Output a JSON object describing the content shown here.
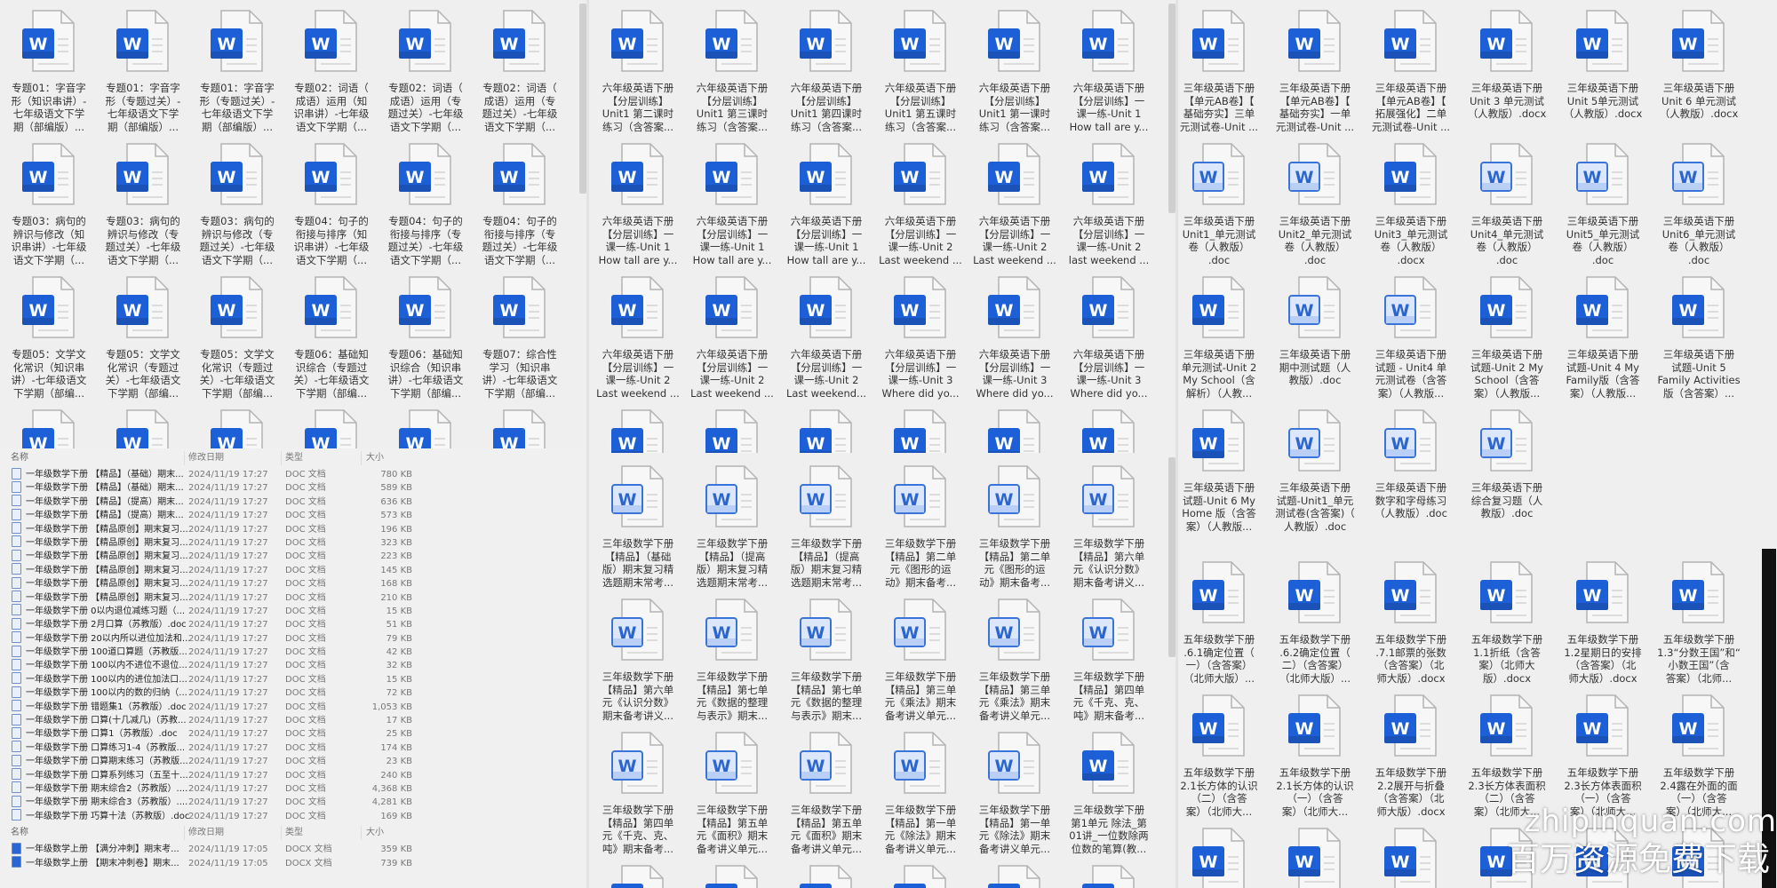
{
  "icons": {
    "solid": "word-solid",
    "light": "word-light",
    "accent": "#1d5fd6",
    "light_fill": "#dce7fb"
  },
  "left_grid": [
    {
      "label": "专题01：字音字\n形（知识串讲）-\n七年级语文下学\n期（部编版）...",
      "icon": "solid"
    },
    {
      "label": "专题01：字音字\n形（专题过关）-\n七年级语文下学\n期（部编版）...",
      "icon": "solid"
    },
    {
      "label": "专题01：字音字\n形（专题过关）-\n七年级语文下学\n期（部编版）...",
      "icon": "solid"
    },
    {
      "label": "专题02：词语（\n成语）运用（知\n识串讲）-七年级\n语文下学期（...",
      "icon": "solid"
    },
    {
      "label": "专题02：词语（\n成语）运用（专\n题过关）-七年级\n语文下学期（...",
      "icon": "solid"
    },
    {
      "label": "专题02：词语（\n成语）运用（专\n题过关）-七年级\n语文下学期（...",
      "icon": "solid"
    },
    {
      "label": "专题03：病句的\n辨识与修改（知\n识串讲）-七年级\n语文下学期（...",
      "icon": "solid"
    },
    {
      "label": "专题03：病句的\n辨识与修改（专\n题过关）-七年级\n语文下学期（...",
      "icon": "solid"
    },
    {
      "label": "专题03：病句的\n辨识与修改（专\n题过关）-七年级\n语文下学期（...",
      "icon": "solid"
    },
    {
      "label": "专题04：句子的\n衔接与排序（知\n识串讲）-七年级\n语文下学期（...",
      "icon": "solid"
    },
    {
      "label": "专题04：句子的\n衔接与排序（专\n题过关）-七年级\n语文下学期（...",
      "icon": "solid"
    },
    {
      "label": "专题04：句子的\n衔接与排序（专\n题过关）-七年级\n语文下学期（...",
      "icon": "solid"
    },
    {
      "label": "专题05：文学文\n化常识（知识串\n讲）-七年级语文\n下学期（部编...",
      "icon": "solid"
    },
    {
      "label": "专题05：文学文\n化常识（专题过\n关）-七年级语文\n下学期（部编...",
      "icon": "solid"
    },
    {
      "label": "专题05：文学文\n化常识（专题过\n关）-七年级语文\n下学期（部编...",
      "icon": "solid"
    },
    {
      "label": "专题06：基础知\n识综合（专题过\n关）-七年级语文\n下学期（部编...",
      "icon": "solid"
    },
    {
      "label": "专题06：基础知\n识综合（知识串\n讲）-七年级语文\n下学期（部编...",
      "icon": "solid"
    },
    {
      "label": "专题07：综合性\n学习（知识串\n讲）-七年级语文\n下学期（部编...",
      "icon": "solid"
    },
    {
      "label": "",
      "icon": "solid"
    },
    {
      "label": "",
      "icon": "solid"
    },
    {
      "label": "",
      "icon": "solid"
    },
    {
      "label": "",
      "icon": "solid"
    },
    {
      "label": "",
      "icon": "solid"
    },
    {
      "label": "",
      "icon": "solid"
    }
  ],
  "file_list": {
    "headers": {
      "name": "名称",
      "date": "修改日期",
      "type": "类型",
      "size": "大小"
    },
    "rows": [
      {
        "name": "一年级数学下册 【精品】（基础）期末...",
        "date": "2024/11/19 17:27",
        "type": "DOC 文档",
        "size": "780 KB"
      },
      {
        "name": "一年级数学下册 【精品】（基础）期末...",
        "date": "2024/11/19 17:27",
        "type": "DOC 文档",
        "size": "589 KB"
      },
      {
        "name": "一年级数学下册 【精品】（提高）期末...",
        "date": "2024/11/19 17:27",
        "type": "DOC 文档",
        "size": "636 KB"
      },
      {
        "name": "一年级数学下册 【精品】（提高）期末...",
        "date": "2024/11/19 17:27",
        "type": "DOC 文档",
        "size": "573 KB"
      },
      {
        "name": "一年级数学下册 【精品原创】期末复习...",
        "date": "2024/11/19 17:27",
        "type": "DOC 文档",
        "size": "196 KB"
      },
      {
        "name": "一年级数学下册 【精品原创】期末复习...",
        "date": "2024/11/19 17:27",
        "type": "DOC 文档",
        "size": "323 KB"
      },
      {
        "name": "一年级数学下册 【精品原创】期末复习...",
        "date": "2024/11/19 17:27",
        "type": "DOC 文档",
        "size": "223 KB"
      },
      {
        "name": "一年级数学下册 【精品原创】期末复习...",
        "date": "2024/11/19 17:27",
        "type": "DOC 文档",
        "size": "145 KB"
      },
      {
        "name": "一年级数学下册 【精品原创】期末复习...",
        "date": "2024/11/19 17:27",
        "type": "DOC 文档",
        "size": "168 KB"
      },
      {
        "name": "一年级数学下册 【精品原创】期末复习...",
        "date": "2024/11/19 17:27",
        "type": "DOC 文档",
        "size": "210 KB"
      },
      {
        "name": "一年级数学下册 0以内退位减练习题（...",
        "date": "2024/11/19 17:27",
        "type": "DOC 文档",
        "size": "15 KB"
      },
      {
        "name": "一年级数学下册 2月口算（苏教版）.doc",
        "date": "2024/11/19 17:27",
        "type": "DOC 文档",
        "size": "51 KB"
      },
      {
        "name": "一年级数学下册 20以内所以进位加法和...",
        "date": "2024/11/19 17:27",
        "type": "DOC 文档",
        "size": "79 KB"
      },
      {
        "name": "一年级数学下册 100道口算题（苏教版...",
        "date": "2024/11/19 17:27",
        "type": "DOC 文档",
        "size": "42 KB"
      },
      {
        "name": "一年级数学下册 100以内不进位不退位...",
        "date": "2024/11/19 17:27",
        "type": "DOC 文档",
        "size": "32 KB"
      },
      {
        "name": "一年级数学下册 100以内的进位加法口...",
        "date": "2024/11/19 17:27",
        "type": "DOC 文档",
        "size": "15 KB"
      },
      {
        "name": "一年级数学下册 100以内的数的归纳（...",
        "date": "2024/11/19 17:27",
        "type": "DOC 文档",
        "size": "72 KB"
      },
      {
        "name": "一年级数学下册 错题集1（苏教版）.doc",
        "date": "2024/11/19 17:27",
        "type": "DOC 文档",
        "size": "1,053 KB"
      },
      {
        "name": "一年级数学下册 口算(十几减几)（苏教...",
        "date": "2024/11/19 17:27",
        "type": "DOC 文档",
        "size": "17 KB"
      },
      {
        "name": "一年级数学下册 口算1（苏教版）.doc",
        "date": "2024/11/19 17:27",
        "type": "DOC 文档",
        "size": "25 KB"
      },
      {
        "name": "一年级数学下册 口算练习1-4（苏教版...",
        "date": "2024/11/19 17:27",
        "type": "DOC 文档",
        "size": "174 KB"
      },
      {
        "name": "一年级数学下册 口算期末练习（苏教版...",
        "date": "2024/11/19 17:27",
        "type": "DOC 文档",
        "size": "23 KB"
      },
      {
        "name": "一年级数学下册 口算系列练习（五至十...",
        "date": "2024/11/19 17:27",
        "type": "DOC 文档",
        "size": "240 KB"
      },
      {
        "name": "一年级数学下册 期末综合2（苏教版）....",
        "date": "2024/11/19 17:27",
        "type": "DOC 文档",
        "size": "4,368 KB"
      },
      {
        "name": "一年级数学下册 期末综合3（苏教版）....",
        "date": "2024/11/19 17:27",
        "type": "DOC 文档",
        "size": "4,281 KB"
      },
      {
        "name": "一年级数学下册 巧算十法（苏教版）.doc",
        "date": "2024/11/19 17:27",
        "type": "DOC 文档",
        "size": "169 KB"
      }
    ],
    "rows2": [
      {
        "name": "一年级数学上册 【满分冲刺】期末考...",
        "date": "2024/11/19 17:05",
        "type": "DOCX 文档",
        "size": "359 KB"
      },
      {
        "name": "一年级数学上册 【期末冲刺卷】期末...",
        "date": "2024/11/19 17:05",
        "type": "DOCX 文档",
        "size": "739 KB"
      }
    ]
  },
  "mid_grid": [
    {
      "label": "六年级英语下册\n【分层训练】\nUnit1 第二课时\n练习（含答案...",
      "icon": "solid"
    },
    {
      "label": "六年级英语下册\n【分层训练】\nUnit1 第三课时\n练习（含答案...",
      "icon": "solid"
    },
    {
      "label": "六年级英语下册\n【分层训练】\nUnit1 第四课时\n练习（含答案...",
      "icon": "solid"
    },
    {
      "label": "六年级英语下册\n【分层训练】\nUnit1 第五课时\n练习（含答案...",
      "icon": "solid"
    },
    {
      "label": "六年级英语下册\n【分层训练】\nUnit1 第一课时\n练习（含答案...",
      "icon": "solid"
    },
    {
      "label": "六年级英语下册\n【分层训练】一\n课一练-Unit 1\nHow tall are y...",
      "icon": "solid"
    },
    {
      "label": "六年级英语下册\n【分层训练】一\n课一练-Unit 1\nHow tall are y...",
      "icon": "solid"
    },
    {
      "label": "六年级英语下册\n【分层训练】一\n课一练-Unit 1\nHow tall are y...",
      "icon": "solid"
    },
    {
      "label": "六年级英语下册\n【分层训练】一\n课一练-Unit 1\nHow tall are y...",
      "icon": "solid"
    },
    {
      "label": "六年级英语下册\n【分层训练】一\n课一练-Unit 2\nLast weekend ...",
      "icon": "solid"
    },
    {
      "label": "六年级英语下册\n【分层训练】一\n课一练-Unit 2\nLast weekend ...",
      "icon": "solid"
    },
    {
      "label": "六年级英语下册\n【分层训练】一\n课一练-Unit 2\nlast weekend ...",
      "icon": "solid"
    },
    {
      "label": "六年级英语下册\n【分层训练】一\n课一练-Unit 2\nLast weekend ...",
      "icon": "solid"
    },
    {
      "label": "六年级英语下册\n【分层训练】一\n课一练-Unit 2\nLast weekend ...",
      "icon": "solid"
    },
    {
      "label": "六年级英语下册\n【分层训练】一\n课一练-Unit 2\nLast weekend...",
      "icon": "solid"
    },
    {
      "label": "六年级英语下册\n【分层训练】一\n课一练-Unit 3\nWhere did yo...",
      "icon": "solid"
    },
    {
      "label": "六年级英语下册\n【分层训练】一\n课一练-Unit 3\nWhere did yo...",
      "icon": "solid"
    },
    {
      "label": "六年级英语下册\n【分层训练】一\n课一练-Unit 3\nWhere did yo...",
      "icon": "solid"
    },
    {
      "label": "",
      "icon": "solid"
    },
    {
      "label": "",
      "icon": "solid"
    },
    {
      "label": "",
      "icon": "solid"
    },
    {
      "label": "",
      "icon": "solid"
    },
    {
      "label": "",
      "icon": "solid"
    },
    {
      "label": "",
      "icon": "solid"
    }
  ],
  "mid_math_grid": [
    {
      "label": "三年级数学下册\n【精品】（基础\n版）期末复习精\n选题期末常考...",
      "icon": "light"
    },
    {
      "label": "三年级数学下册\n【精品】（提高\n版）期末复习精\n选题期末常考...",
      "icon": "light"
    },
    {
      "label": "三年级数学下册\n【精品】（提高\n版）期末复习精\n选题期末常考...",
      "icon": "light"
    },
    {
      "label": "三年级数学下册\n【精品】第二单\n元《图形的运\n动》期末备考...",
      "icon": "light"
    },
    {
      "label": "三年级数学下册\n【精品】第二单\n元《图形的运\n动》期末备考...",
      "icon": "light"
    },
    {
      "label": "三年级数学下册\n【精品】第六单\n元《认识分数》\n期末备考讲义...",
      "icon": "light"
    },
    {
      "label": "三年级数学下册\n【精品】第六单\n元《认识分数》\n期末备考讲义...",
      "icon": "light"
    },
    {
      "label": "三年级数学下册\n【精品】第七单\n元《数据的整理\n与表示》期末...",
      "icon": "light"
    },
    {
      "label": "三年级数学下册\n【精品】第七单\n元《数据的整理\n与表示》期末...",
      "icon": "light"
    },
    {
      "label": "三年级数学下册\n【精品】第三单\n元《乘法》期末\n备考讲义单元...",
      "icon": "light"
    },
    {
      "label": "三年级数学下册\n【精品】第三单\n元《乘法》期末\n备考讲义单元...",
      "icon": "light"
    },
    {
      "label": "三年级数学下册\n【精品】第四单\n元《千克、克、\n吨》期末备考...",
      "icon": "light"
    },
    {
      "label": "三年级数学下册\n【精品】第四单\n元《千克、克、\n吨》期末备考...",
      "icon": "light"
    },
    {
      "label": "三年级数学下册\n【精品】第五单\n元《面积》期末\n备考讲义单元...",
      "icon": "light"
    },
    {
      "label": "三年级数学下册\n【精品】第五单\n元《面积》期末\n备考讲义单元...",
      "icon": "light"
    },
    {
      "label": "三年级数学下册\n【精品】第一单\n元《除法》期末\n备考讲义单元...",
      "icon": "light"
    },
    {
      "label": "三年级数学下册\n【精品】第一单\n元《除法》期末\n备考讲义单元...",
      "icon": "light"
    },
    {
      "label": "三年级数学下册\n第1单元 除法_第\n01讲_一位数除两\n位数的笔算(教...",
      "icon": "solid"
    },
    {
      "label": "",
      "icon": "solid"
    },
    {
      "label": "",
      "icon": "solid"
    },
    {
      "label": "",
      "icon": "solid"
    },
    {
      "label": "",
      "icon": "solid"
    },
    {
      "label": "",
      "icon": "solid"
    },
    {
      "label": "",
      "icon": "solid"
    }
  ],
  "right_grid": [
    {
      "label": "三年级英语下册\n【单元AB卷】【\n基础夯实】三单\n元测试卷-Unit ...",
      "icon": "solid"
    },
    {
      "label": "三年级英语下册\n【单元AB卷】【\n基础夯实】一单\n元测试卷-Unit ...",
      "icon": "solid"
    },
    {
      "label": "三年级英语下册\n【单元AB卷】【\n拓展强化】二单\n元测试卷-Unit ...",
      "icon": "solid"
    },
    {
      "label": "三年级英语下册\nUnit 3 单元测试\n（人教版）.docx",
      "icon": "solid"
    },
    {
      "label": "三年级英语下册\nUnit 5单元测试\n（人教版）.docx",
      "icon": "solid"
    },
    {
      "label": "三年级英语下册\nUnit 6 单元测试\n（人教版）.docx",
      "icon": "solid"
    },
    {
      "label": "三年级英语下册\nUnit1_单元测试\n卷（人教版）\n.doc",
      "icon": "light"
    },
    {
      "label": "三年级英语下册\nUnit2_单元测试\n卷（人教版）\n.doc",
      "icon": "light"
    },
    {
      "label": "三年级英语下册\nUnit3_单元测试\n卷（人教版）\n.docx",
      "icon": "solid"
    },
    {
      "label": "三年级英语下册\nUnit4_单元测试\n卷（人教版）\n.doc",
      "icon": "light"
    },
    {
      "label": "三年级英语下册\nUnit5_单元测试\n卷（人教版）\n.doc",
      "icon": "light"
    },
    {
      "label": "三年级英语下册\nUnit6_单元测试\n卷（人教版）\n.doc",
      "icon": "light"
    },
    {
      "label": "三年级英语下册\n单元测试-Unit 2\nMy School（含\n解析）（人教...",
      "icon": "solid"
    },
    {
      "label": "三年级英语下册\n期中测试题（人\n教版）.doc",
      "icon": "light"
    },
    {
      "label": "三年级英语下册\n试题 - Unit4 单\n元测试卷（含答\n案）（人教版...",
      "icon": "light"
    },
    {
      "label": "三年级英语下册\n试题-Unit 2 My\nSchool（含答\n案）（人教版...",
      "icon": "solid"
    },
    {
      "label": "三年级英语下册\n试题-Unit 4 My\nFamily版（含答\n案）（人教版...",
      "icon": "solid"
    },
    {
      "label": "三年级英语下册\n试题-Unit 5\nFamily Activities\n版（含答案）...",
      "icon": "solid"
    },
    {
      "label": "三年级英语下册\n试题-Unit 6 My\nHome 版（含答\n案）（人教版...",
      "icon": "solid"
    },
    {
      "label": "三年级英语下册\n试题-Unit1_单元\n测试卷(含答案)（\n人教版）.doc",
      "icon": "light"
    },
    {
      "label": "三年级英语下册\n数字和字母练习\n（人教版）.doc",
      "icon": "light"
    },
    {
      "label": "三年级英语下册\n综合复习题（人\n教版）.doc",
      "icon": "light"
    }
  ],
  "right_math_grid": [
    {
      "label": "五年级数学下册\n.6.1确定位置（\n一）（含答案）\n（北师大版）...",
      "icon": "solid"
    },
    {
      "label": "五年级数学下册\n.6.2确定位置（\n二）（含答案）\n（北师大版）...",
      "icon": "solid"
    },
    {
      "label": "五年级数学下册\n.7.1邮票的张数\n（含答案）（北\n师大版）.docx",
      "icon": "solid"
    },
    {
      "label": "五年级数学下册\n1.1折纸（含答\n案）（北师大\n版）.docx",
      "icon": "solid"
    },
    {
      "label": "五年级数学下册\n1.2星期日的安排\n（含答案）（北\n师大版）.docx",
      "icon": "solid"
    },
    {
      "label": "五年级数学下册\n1.3“分数王国”和“\n小数王国”（含\n答案）（北师...",
      "icon": "solid"
    },
    {
      "label": "五年级数学下册\n2.1长方体的认识\n（二）（含答\n案）（北师大...",
      "icon": "solid"
    },
    {
      "label": "五年级数学下册\n2.1长方体的认识\n（一）（含答\n案）（北师大...",
      "icon": "solid"
    },
    {
      "label": "五年级数学下册\n2.2展开与折叠\n（含答案）（北\n师大版）.docx",
      "icon": "solid"
    },
    {
      "label": "五年级数学下册\n2.3长方体表面积\n（二）（含答\n案）（北师大...",
      "icon": "solid"
    },
    {
      "label": "五年级数学下册\n2.3长方体表面积\n（一）（含答\n案）（北师大...",
      "icon": "solid"
    },
    {
      "label": "五年级数学下册\n2.4露在外面的面\n（一）（含答\n案）（北师大...",
      "icon": "solid"
    },
    {
      "label": "",
      "icon": "solid"
    },
    {
      "label": "",
      "icon": "solid"
    },
    {
      "label": "",
      "icon": "solid"
    },
    {
      "label": "",
      "icon": "solid"
    },
    {
      "label": "",
      "icon": "solid"
    },
    {
      "label": "",
      "icon": "solid"
    }
  ],
  "watermark": {
    "domain": "zhipinquan.com",
    "slogan": "百万资源免费下载"
  }
}
